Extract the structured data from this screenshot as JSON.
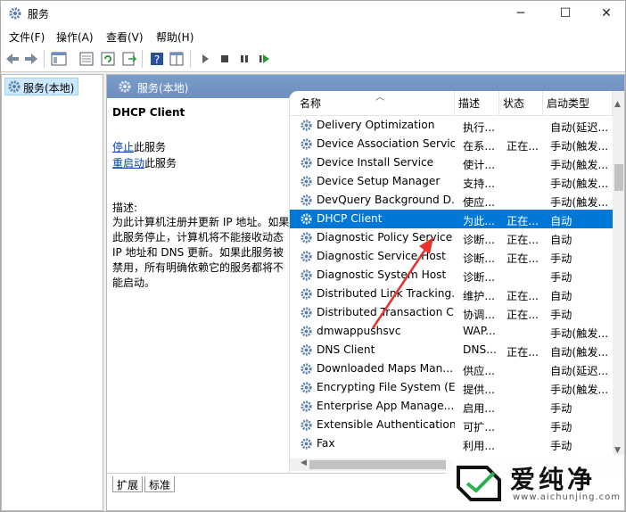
{
  "window": {
    "title": "服务",
    "controls": {
      "minimize": "─",
      "maximize": "☐",
      "close": "✕"
    }
  },
  "menu": [
    "文件(F)",
    "操作(A)",
    "查看(V)",
    "帮助(H)"
  ],
  "tree": {
    "root": "服务(本地)"
  },
  "panel": {
    "header": "服务(本地)",
    "service_name": "DHCP Client",
    "stop_link": "停止",
    "stop_rest": "此服务",
    "restart_link": "重启动",
    "restart_rest": "此服务",
    "description_label": "描述:",
    "description": "为此计算机注册并更新 IP 地址。如果此服务停止，计算机将不能接收动态 IP 地址和 DNS 更新。如果此服务被禁用，所有明确依赖它的服务都将不能启动。"
  },
  "columns": {
    "name": "名称",
    "desc": "描述",
    "status": "状态",
    "startup": "启动类型"
  },
  "services": [
    {
      "name": "Delivery Optimization",
      "desc": "执行...",
      "status": "",
      "startup": "自动(延迟..."
    },
    {
      "name": "Device Association Service",
      "desc": "在系...",
      "status": "正在...",
      "startup": "手动(触发..."
    },
    {
      "name": "Device Install Service",
      "desc": "使计...",
      "status": "",
      "startup": "手动(触发..."
    },
    {
      "name": "Device Setup Manager",
      "desc": "支持...",
      "status": "",
      "startup": "手动(触发..."
    },
    {
      "name": "DevQuery Background D...",
      "desc": "使应...",
      "status": "",
      "startup": "手动(触发..."
    },
    {
      "name": "DHCP Client",
      "desc": "为此...",
      "status": "正在...",
      "startup": "自动",
      "selected": true
    },
    {
      "name": "Diagnostic Policy Service",
      "desc": "诊断...",
      "status": "正在...",
      "startup": "自动"
    },
    {
      "name": "Diagnostic Service Host",
      "desc": "诊断...",
      "status": "正在...",
      "startup": "手动"
    },
    {
      "name": "Diagnostic System Host",
      "desc": "诊断...",
      "status": "",
      "startup": "手动"
    },
    {
      "name": "Distributed Link Tracking...",
      "desc": "维护...",
      "status": "正在...",
      "startup": "自动"
    },
    {
      "name": "Distributed Transaction C...",
      "desc": "协调...",
      "status": "正在...",
      "startup": "手动"
    },
    {
      "name": "dmwappushsvc",
      "desc": "WAP...",
      "status": "",
      "startup": "手动(触发..."
    },
    {
      "name": "DNS Client",
      "desc": "DNS...",
      "status": "正在...",
      "startup": "自动(触发..."
    },
    {
      "name": "Downloaded Maps Man...",
      "desc": "供应...",
      "status": "",
      "startup": "自动(延迟..."
    },
    {
      "name": "Encrypting File System (E...",
      "desc": "提供...",
      "status": "",
      "startup": "手动(触发..."
    },
    {
      "name": "Enterprise App Manage...",
      "desc": "启用...",
      "status": "",
      "startup": "手动"
    },
    {
      "name": "Extensible Authentication...",
      "desc": "可扩...",
      "status": "",
      "startup": "手动"
    },
    {
      "name": "Fax",
      "desc": "利用...",
      "status": "",
      "startup": "手动"
    }
  ],
  "tabs": [
    "扩展",
    "标准"
  ],
  "watermark": {
    "text": "爱纯净",
    "url": "www.aichunjing.com"
  },
  "colors": {
    "selection": "#0078d7",
    "header": "#7293c3",
    "link": "#0645ad",
    "arrow": "#e8322c"
  }
}
